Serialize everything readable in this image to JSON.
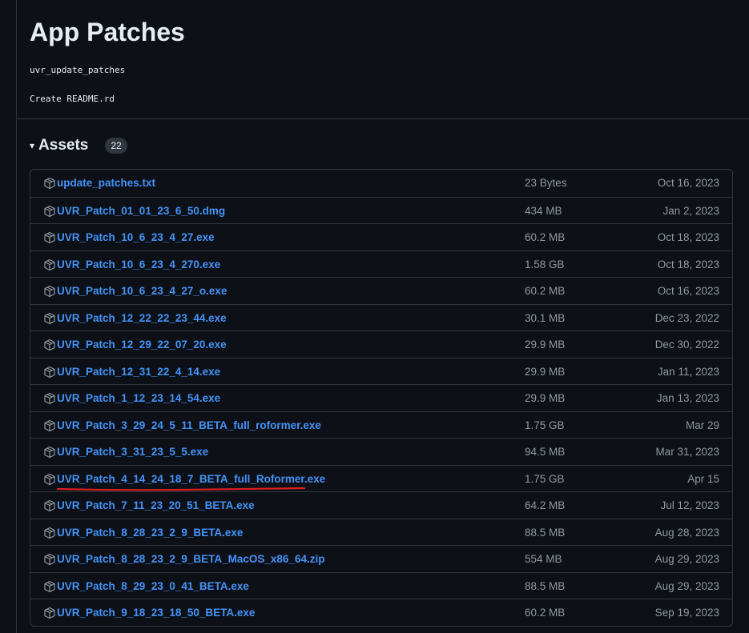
{
  "release": {
    "title": "App Patches",
    "tag_line": "uvr_update_patches",
    "commit_line": "Create README.rd"
  },
  "assets": {
    "heading": "Assets",
    "count": "22",
    "caret_glyph": "▾",
    "annotation_color": "#e01e1e",
    "items": [
      {
        "name": "update_patches.txt",
        "size": "23 Bytes",
        "date": "Oct 16, 2023"
      },
      {
        "name": "UVR_Patch_01_01_23_6_50.dmg",
        "size": "434 MB",
        "date": "Jan 2, 2023"
      },
      {
        "name": "UVR_Patch_10_6_23_4_27.exe",
        "size": "60.2 MB",
        "date": "Oct 18, 2023"
      },
      {
        "name": "UVR_Patch_10_6_23_4_270.exe",
        "size": "1.58 GB",
        "date": "Oct 18, 2023"
      },
      {
        "name": "UVR_Patch_10_6_23_4_27_o.exe",
        "size": "60.2 MB",
        "date": "Oct 16, 2023"
      },
      {
        "name": "UVR_Patch_12_22_22_23_44.exe",
        "size": "30.1 MB",
        "date": "Dec 23, 2022"
      },
      {
        "name": "UVR_Patch_12_29_22_07_20.exe",
        "size": "29.9 MB",
        "date": "Dec 30, 2022"
      },
      {
        "name": "UVR_Patch_12_31_22_4_14.exe",
        "size": "29.9 MB",
        "date": "Jan 11, 2023"
      },
      {
        "name": "UVR_Patch_1_12_23_14_54.exe",
        "size": "29.9 MB",
        "date": "Jan 13, 2023"
      },
      {
        "name": "UVR_Patch_3_29_24_5_11_BETA_full_roformer.exe",
        "size": "1.75 GB",
        "date": "Mar 29"
      },
      {
        "name": "UVR_Patch_3_31_23_5_5.exe",
        "size": "94.5 MB",
        "date": "Mar 31, 2023"
      },
      {
        "name": "UVR_Patch_4_14_24_18_7_BETA_full_Roformer.exe",
        "size": "1.75 GB",
        "date": "Apr 15"
      },
      {
        "name": "UVR_Patch_7_11_23_20_51_BETA.exe",
        "size": "64.2 MB",
        "date": "Jul 12, 2023"
      },
      {
        "name": "UVR_Patch_8_28_23_2_9_BETA.exe",
        "size": "88.5 MB",
        "date": "Aug 28, 2023"
      },
      {
        "name": "UVR_Patch_8_28_23_2_9_BETA_MacOS_x86_64.zip",
        "size": "554 MB",
        "date": "Aug 29, 2023"
      },
      {
        "name": "UVR_Patch_8_29_23_0_41_BETA.exe",
        "size": "88.5 MB",
        "date": "Aug 29, 2023"
      },
      {
        "name": "UVR_Patch_9_18_23_18_50_BETA.exe",
        "size": "60.2 MB",
        "date": "Sep 19, 2023"
      }
    ]
  }
}
